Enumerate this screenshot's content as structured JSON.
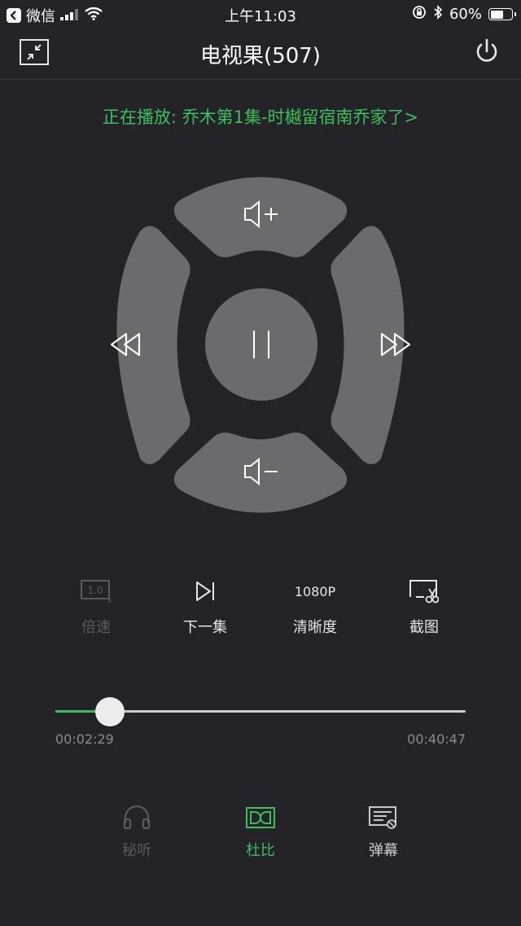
{
  "status_bar": {
    "back_app": "微信",
    "time": "上午11:03",
    "battery": "60%",
    "battery_level": 0.6
  },
  "header": {
    "title": "电视果(507)",
    "shrink_icon": "shrink-arrows-icon",
    "power_icon": "power-icon"
  },
  "now_playing": "正在播放: 乔木第1集-时樾留宿南乔家了>",
  "dpad": {
    "up_icon": "volume-up-icon",
    "down_icon": "volume-down-icon",
    "left_icon": "rewind-icon",
    "right_icon": "fast-forward-icon",
    "center_icon": "pause-icon"
  },
  "controls": [
    {
      "label": "倍速",
      "icon_text": "1.0",
      "icon": "speed-icon",
      "enabled": false
    },
    {
      "label": "下一集",
      "icon": "next-episode-icon",
      "enabled": true
    },
    {
      "label": "清晰度",
      "icon_text": "1080P",
      "icon": "resolution-icon",
      "enabled": true
    },
    {
      "label": "截图",
      "icon": "screenshot-icon",
      "enabled": true
    }
  ],
  "progress": {
    "current": "00:02:29",
    "total": "00:40:47",
    "fraction": 0.061
  },
  "bottom": [
    {
      "label": "秘听",
      "icon": "headphones-icon",
      "active": false
    },
    {
      "label": "杜比",
      "icon": "dolby-icon",
      "active": true
    },
    {
      "label": "弹幕",
      "icon": "danmaku-icon",
      "active": false
    }
  ],
  "colors": {
    "background": "#242428",
    "accent": "#3bbf5a",
    "dpad": "#6b6b6e",
    "disabled": "#5a5a5e"
  }
}
